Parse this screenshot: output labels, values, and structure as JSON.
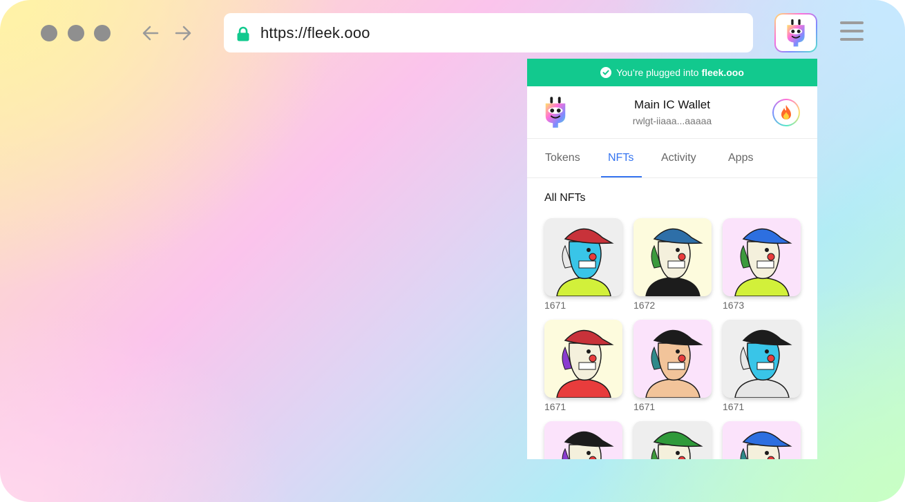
{
  "browser": {
    "url": "https://fleek.ooo"
  },
  "banner": {
    "text": "You’re plugged into",
    "site": "fleek.ooo"
  },
  "wallet": {
    "name": "Main IC Wallet",
    "address": "rwlgt-iiaaa...aaaaa"
  },
  "tabs": [
    {
      "label": "Tokens",
      "active": false
    },
    {
      "label": "NFTs",
      "active": true
    },
    {
      "label": "Activity",
      "active": false
    },
    {
      "label": "Apps",
      "active": false
    }
  ],
  "nfts": {
    "title": "All NFTs",
    "items": [
      {
        "id": "1671",
        "bg": "#eeeeee",
        "hat": "#c8323a",
        "skin": "#39c5e8",
        "shirt": "#d2f03a",
        "hair": "#e8e8e8"
      },
      {
        "id": "1672",
        "bg": "#fdfbdd",
        "hat": "#2e6fa8",
        "skin": "#f4f0dc",
        "shirt": "#1c1c1c",
        "hair": "#3c9a3c"
      },
      {
        "id": "1673",
        "bg": "#fbe3fb",
        "hat": "#2d6fe0",
        "skin": "#f4f0dc",
        "shirt": "#d2f03a",
        "hair": "#3c9a3c"
      },
      {
        "id": "1671",
        "bg": "#fdfbdd",
        "hat": "#c8323a",
        "skin": "#f4f0dc",
        "shirt": "#e83c3c",
        "hair": "#8a3cd0"
      },
      {
        "id": "1671",
        "bg": "#fbe3fb",
        "hat": "#1c1c1c",
        "skin": "#f2c49a",
        "shirt": "#f2c49a",
        "hair": "#2f8a8a"
      },
      {
        "id": "1671",
        "bg": "#eeeeee",
        "hat": "#1c1c1c",
        "skin": "#39c5e8",
        "shirt": "#e6e6e6",
        "hair": "#e8e8e8"
      },
      {
        "id": "",
        "bg": "#fbe3fb",
        "hat": "#1c1c1c",
        "skin": "#f4f0dc",
        "shirt": "#f4f0dc",
        "hair": "#8a3cd0"
      },
      {
        "id": "",
        "bg": "#eeeeee",
        "hat": "#2f9a3a",
        "skin": "#f4f0dc",
        "shirt": "#f4f0dc",
        "hair": "#3c9a3c"
      },
      {
        "id": "",
        "bg": "#fbe3fb",
        "hat": "#2d6fe0",
        "skin": "#f4f0dc",
        "shirt": "#f4f0dc",
        "hair": "#2f8a8a"
      }
    ]
  },
  "icons": {
    "lock": "lock-icon",
    "back": "arrow-left-icon",
    "forward": "arrow-right-icon",
    "menu": "hamburger-menu-icon",
    "plug": "plug-logo-icon",
    "fire": "fire-icon",
    "check": "check-circle-icon"
  },
  "colors": {
    "accent_green": "#12c98e",
    "tab_active": "#3574f0"
  }
}
